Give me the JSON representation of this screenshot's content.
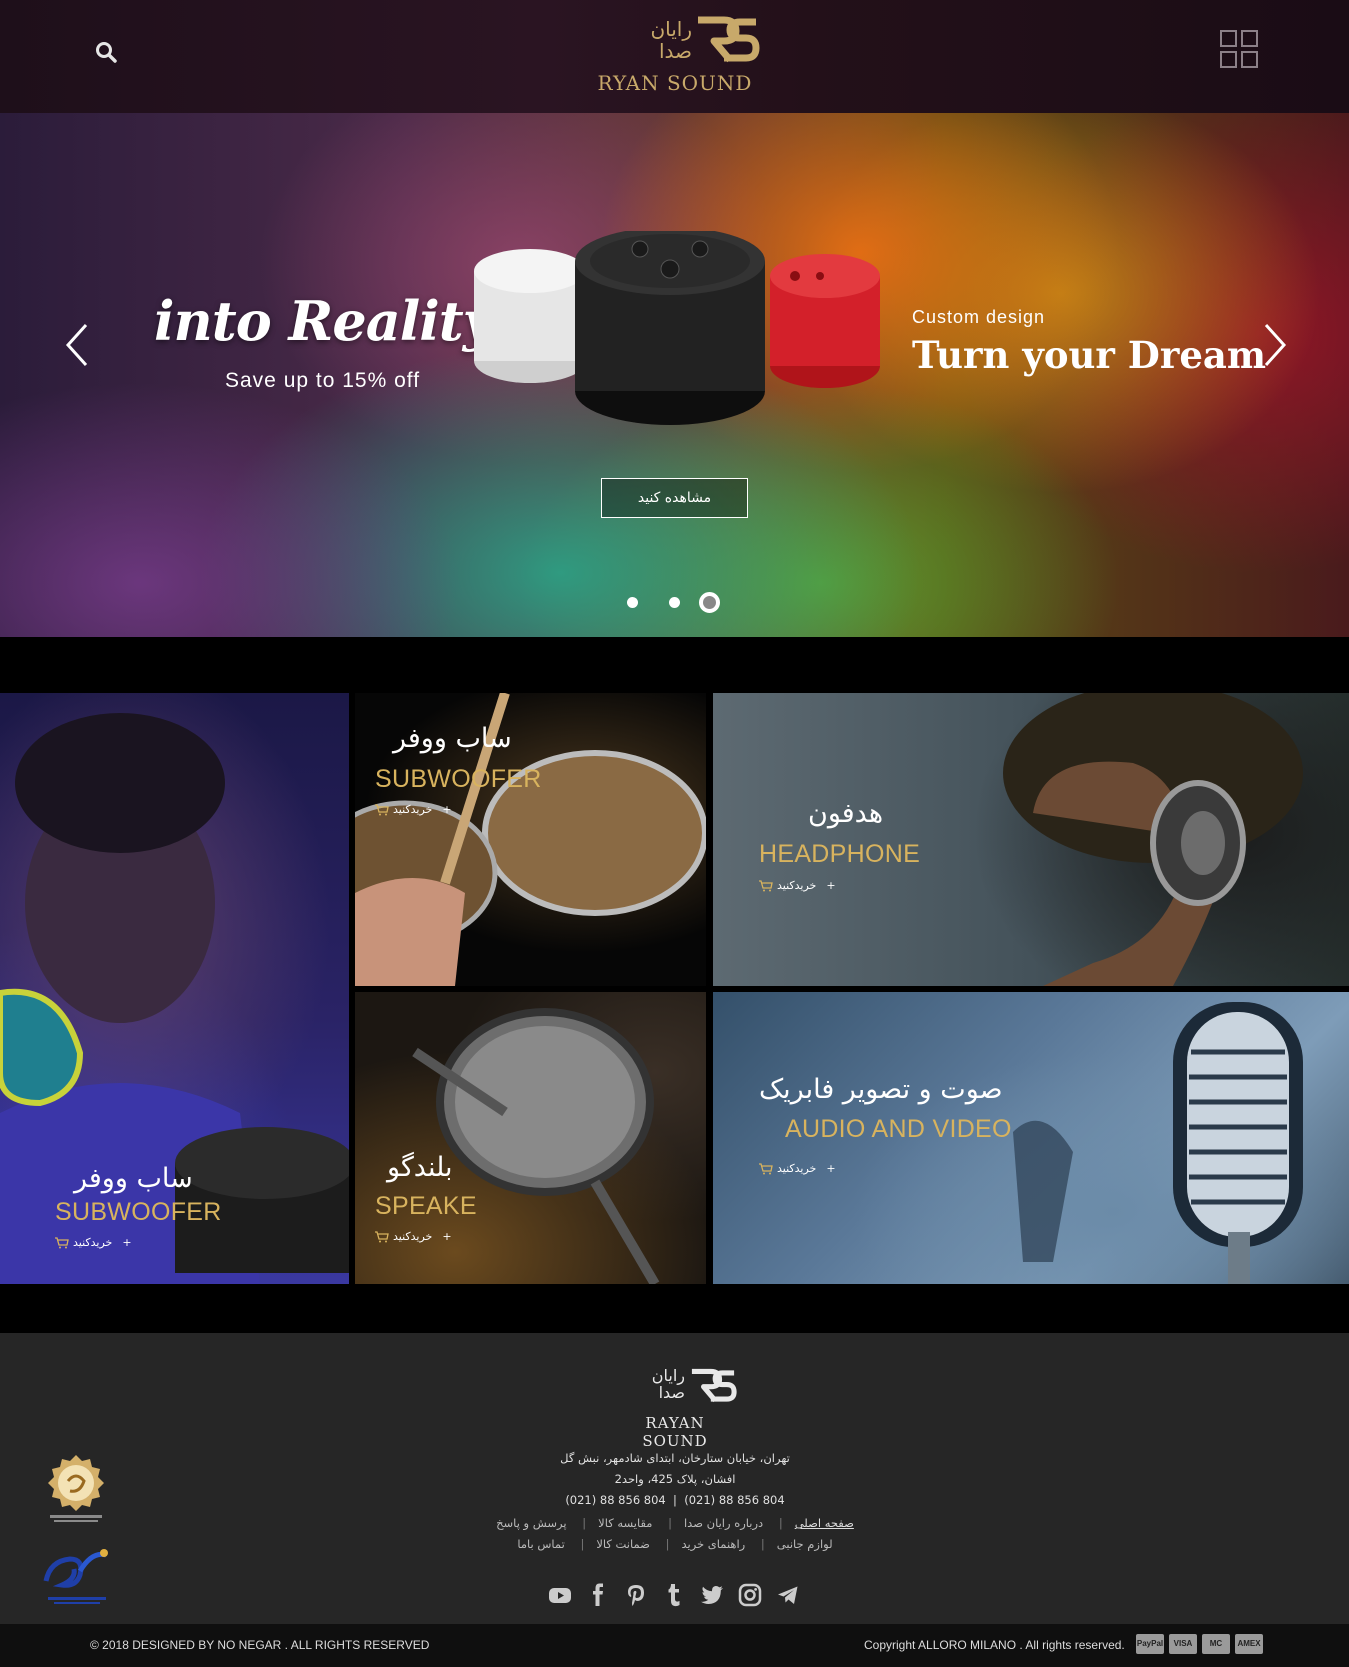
{
  "header": {
    "brand_fa_line1": "رایان",
    "brand_fa_line2": "صدا",
    "brand_en": "RYAN SOUND"
  },
  "hero": {
    "script_title": "into Reality",
    "sale_text": "Save up to 15% off",
    "custom_label": "Custom design",
    "main_title": "Turn your Dream",
    "cta_label": "مشاهده کنید",
    "slide_count": 3,
    "active_slide": 3
  },
  "categories": [
    {
      "fa": "ساب ووفر",
      "en": "SUBWOOFER",
      "buy": "خریدکنید"
    },
    {
      "fa": "ساب ووفر",
      "en": "SUBWOOFER",
      "buy": "خریدکنید"
    },
    {
      "fa": "هدفون",
      "en": "HEADPHONE",
      "buy": "خریدکنید"
    },
    {
      "fa": "بلندگو",
      "en": "SPEAKE",
      "buy": "خریدکنید"
    },
    {
      "fa": "صوت و تصویر فابریک",
      "en": "AUDIO AND VIDEO",
      "buy": "خریدکنید"
    }
  ],
  "footer": {
    "brand_fa_line1": "رایان",
    "brand_fa_line2": "صدا",
    "brand_en": "RAYAN SOUND",
    "address_line1": "تهران، خیابان ستارخان، ابتدای شادمهر، نبش گل",
    "address_line2": "افشان، پلاک 425، واحد2",
    "phone1": "(021) 88 856 804",
    "phone2": "(021) 88 856 804",
    "links_row1": [
      "صفحه اصلی",
      "درباره رایان صدا",
      "مقایسه کالا",
      "پرسش و پاسخ"
    ],
    "links_row2": [
      "لوازم جانبی",
      "راهنمای خرید",
      "ضمانت کالا",
      "تماس باما"
    ],
    "social": [
      "telegram-icon",
      "instagram-icon",
      "twitter-icon",
      "tumblr-icon",
      "pinterest-icon",
      "facebook-icon",
      "youtube-icon"
    ],
    "badge_small_text": "SAMANDEHI"
  },
  "bottom": {
    "copyright_left": "© 2018 DESIGNED BY NO NEGAR . ALL RIGHTS RESERVED",
    "copyright_right": "Copyright ALLORO MILANO . All rights reserved.",
    "payment_methods": [
      "PayPal",
      "VISA",
      "MC",
      "AMEX"
    ]
  },
  "colors": {
    "gold": "#d8b35e",
    "footer_bg": "#262626",
    "bottom_bg": "#0f0f0f"
  }
}
